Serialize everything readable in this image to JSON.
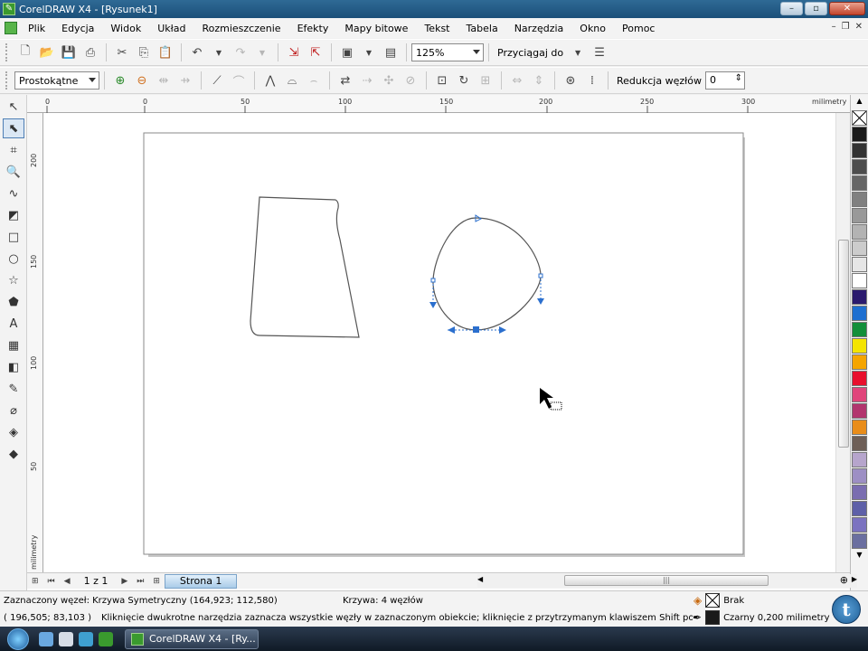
{
  "window": {
    "title": "CorelDRAW X4 - [Rysunek1]"
  },
  "menu": {
    "items": [
      "Plik",
      "Edycja",
      "Widok",
      "Układ",
      "Rozmieszczenie",
      "Efekty",
      "Mapy bitowe",
      "Tekst",
      "Tabela",
      "Narzędzia",
      "Okno",
      "Pomoc"
    ]
  },
  "toolbar1": {
    "zoom_value": "125%",
    "snap_label": "Przyciągaj do"
  },
  "toolbar2": {
    "node_type_value": "Prostokątne",
    "node_reduction_label": "Redukcja węzłów",
    "node_reduction_value": "0"
  },
  "rulers": {
    "h_unit": "milimetry",
    "v_unit": "milimetry",
    "h_ticks": [
      "0",
      "50",
      "100",
      "150",
      "200",
      "250",
      "300"
    ],
    "v_ticks": [
      "200",
      "150",
      "100",
      "50"
    ]
  },
  "pagenav": {
    "counter": "1 z 1",
    "tab_label": "Strona 1"
  },
  "palette": {
    "colors": [
      "#1a1a1a",
      "#333333",
      "#4d4d4d",
      "#666666",
      "#808080",
      "#999999",
      "#b3b3b3",
      "#cccccc",
      "#e6e6e6",
      "#ffffff",
      "#2b1a6e",
      "#1e6fd0",
      "#138f3a",
      "#f4e400",
      "#f5a500",
      "#e8102d",
      "#e0457b",
      "#b2356e",
      "#e98d1a",
      "#6e5f57",
      "#b6a5cc",
      "#9d8fc4",
      "#7a6db0",
      "#5e60a8",
      "#7b72c0",
      "#6b6fa0"
    ]
  },
  "status": {
    "selected_node": "Zaznaczony węzeł: Krzywa Symetryczny (164,923; 112,580)",
    "curve_info": "Krzywa: 4 węzłów",
    "fill_label": "Brak",
    "coords": "( 196,505; 83,103 )",
    "hint": "Kliknięcie dwukrotne narzędzia zaznacza wszystkie węzły w zaznaczonym obiekcie; kliknięcie z przytrzymanym klawiszem Shift pozwala na zazn...",
    "outline_label": "Czarny  0,200 milimetry"
  },
  "taskbar": {
    "active_task": "CorelDRAW X4 - [Ry..."
  }
}
